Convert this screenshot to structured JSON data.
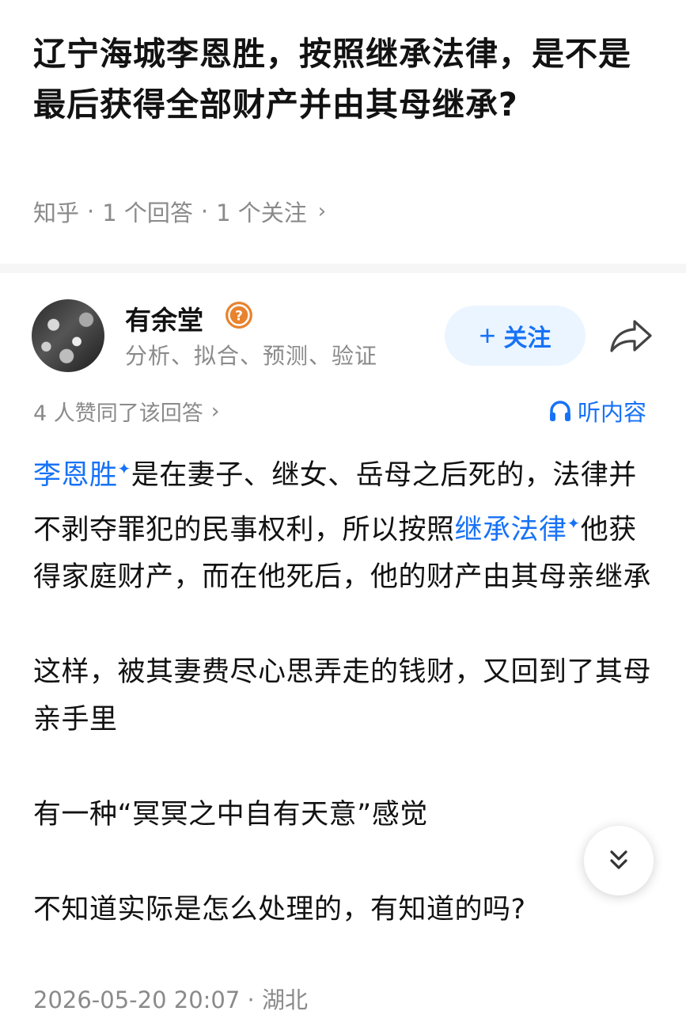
{
  "question": {
    "title": "辽宁海城李恩胜，按照继承法律，是不是最后获得全部财产并由其母继承?",
    "source": "知乎",
    "sep": "·",
    "answers": "1 个回答",
    "follows": "1 个关注",
    "chevron": "›"
  },
  "author": {
    "name": "有余堂",
    "badge": "?",
    "bio": "分析、拟合、预测、验证",
    "follow_plus": "+",
    "follow_label": "关注",
    "badge_color": "#e8832e"
  },
  "answer_meta": {
    "agree_text": "4 人赞同了该回答",
    "chevron": "›",
    "listen_label": "听内容"
  },
  "answer": {
    "p1": {
      "link1": "李恩胜",
      "spark": "✦",
      "seg1": "是在妻子、继女、岳母之后死的，法律并不剥夺罪犯的民事权利，所以按照",
      "link2": "继承法律",
      "seg2": "他获得家庭财产，而在他死后，他的财产由其母亲继承"
    },
    "p2": "这样，被其妻费尽心思弄走的钱财，又回到了其母亲手里",
    "p3": "有一种“冥冥之中自有天意”感觉",
    "p4": "不知道实际是怎么处理的，有知道的吗?"
  },
  "footer": {
    "date": "2026-05-20 20:07",
    "sep": "·",
    "location": "湖北"
  },
  "colors": {
    "accent": "#1772f6",
    "follow_bg": "#ebf5ff",
    "meta_gray": "#8a8a8a"
  }
}
